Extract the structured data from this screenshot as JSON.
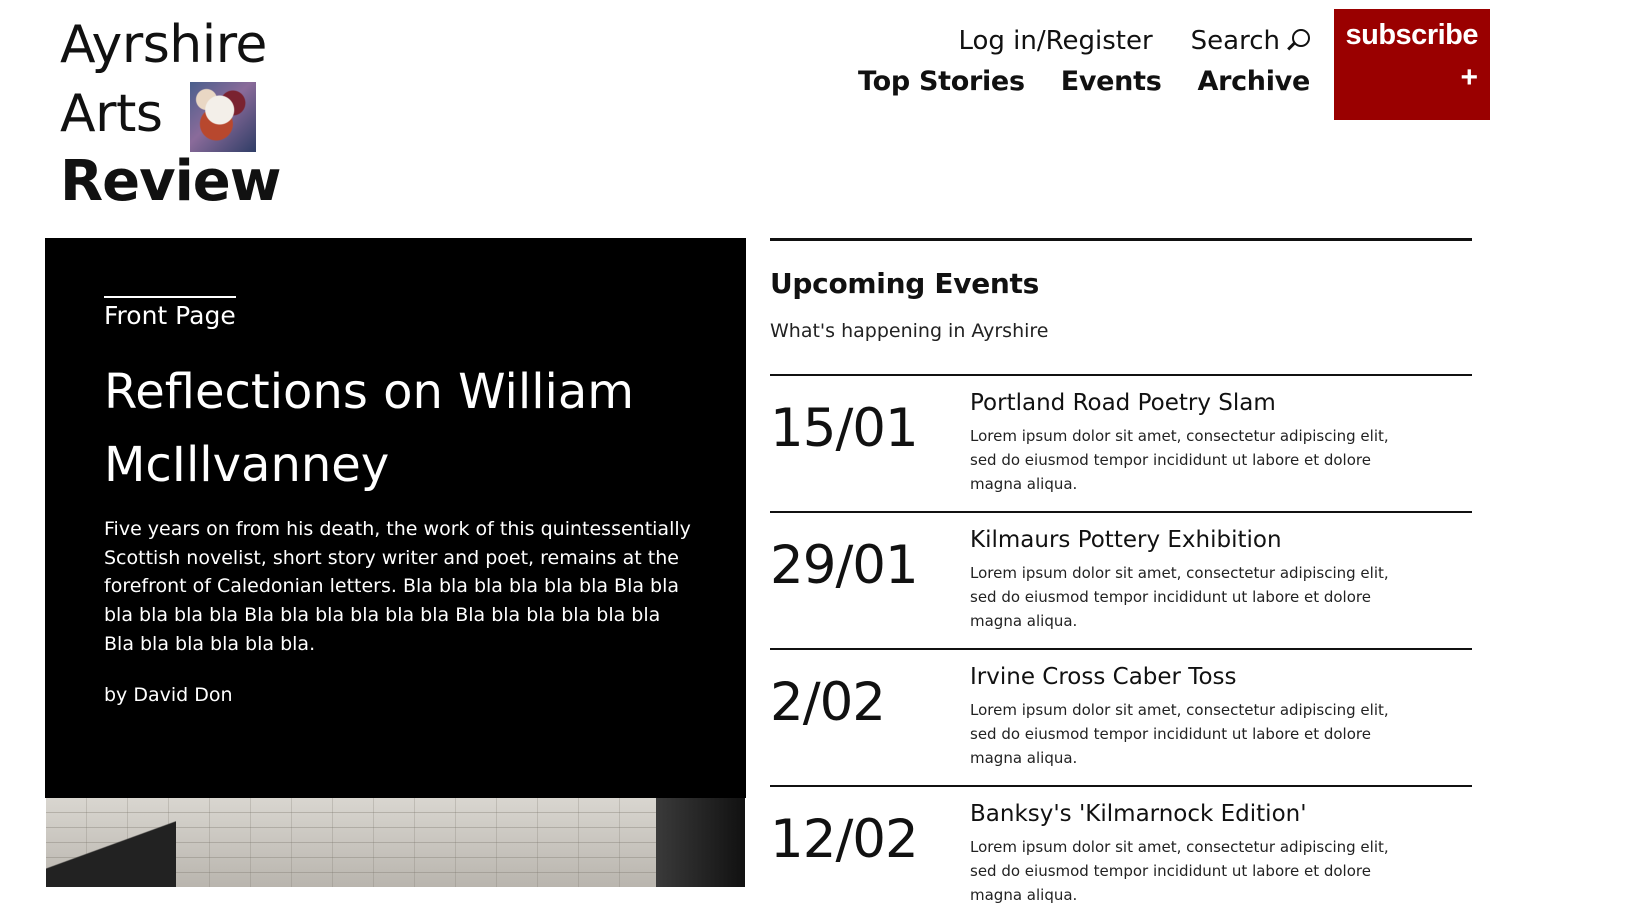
{
  "logo": {
    "line1": "Ayrshire",
    "line2": "Arts",
    "line3": "Review"
  },
  "util_nav": {
    "login_label": "Log in/Register",
    "search_label": "Search"
  },
  "main_nav": {
    "items": [
      {
        "label": "Top Stories"
      },
      {
        "label": "Events"
      },
      {
        "label": "Archive"
      }
    ]
  },
  "subscribe": {
    "label": "subscribe",
    "plus": "+",
    "background": "#9a0000"
  },
  "hero": {
    "kicker": "Front Page",
    "title": "Reflections on William McIllvanney",
    "summary": "Five years on from his death, the work of this quintessentially Scottish novelist, short story writer and poet, remains at the forefront of Caledonian letters. Bla bla bla bla bla bla Bla bla bla bla bla bla Bla bla bla bla bla bla Bla bla bla bla bla bla Bla bla bla bla bla bla.",
    "byline": "by David Don"
  },
  "events": {
    "title": "Upcoming Events",
    "subtitle": "What's happening in Ayrshire",
    "items": [
      {
        "date": "15/01",
        "name": "Portland Road Poetry Slam",
        "description": "Lorem ipsum dolor sit amet, consectetur adipiscing elit, sed do eiusmod tempor incididunt ut labore et dolore magna aliqua."
      },
      {
        "date": "29/01",
        "name": "Kilmaurs Pottery Exhibition",
        "description": "Lorem ipsum dolor sit amet, consectetur adipiscing elit, sed do eiusmod tempor incididunt ut labore et dolore magna aliqua."
      },
      {
        "date": "2/02",
        "name": "Irvine Cross Caber Toss",
        "description": "Lorem ipsum dolor sit amet, consectetur adipiscing elit, sed do eiusmod tempor incididunt ut labore et dolore magna aliqua."
      },
      {
        "date": "12/02",
        "name": "Banksy's 'Kilmarnock Edition'",
        "description": "Lorem ipsum dolor sit amet, consectetur adipiscing elit, sed do eiusmod tempor incididunt ut labore et dolore magna aliqua."
      }
    ]
  }
}
